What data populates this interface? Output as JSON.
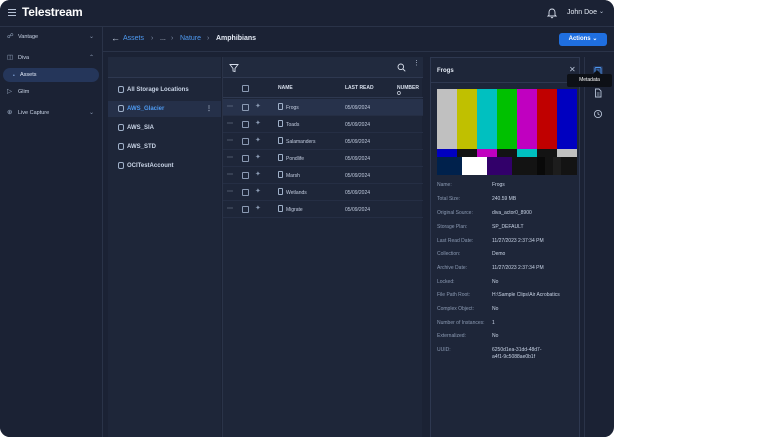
{
  "header": {
    "brand": "Telestream",
    "user_name": "John Doe"
  },
  "sidebar": {
    "items": [
      {
        "label": "Vantage",
        "icon": "share-nodes-icon"
      },
      {
        "label": "Diva",
        "icon": "database-icon"
      },
      {
        "label": "Assets",
        "icon": "dot-icon"
      },
      {
        "label": "Glim",
        "icon": "play-icon"
      },
      {
        "label": "Live Capture",
        "icon": "broadcast-icon"
      }
    ]
  },
  "breadcrumb": {
    "items": [
      "Assets",
      "...",
      "Nature",
      "Amphibians"
    ],
    "actions_label": "Actions"
  },
  "storage": {
    "items": [
      "All Storage Locations",
      "AWS_Glacier",
      "AWS_SIA",
      "AWS_STD",
      "OCITestAccount"
    ]
  },
  "files": {
    "columns": [
      "NAME",
      "LAST READ",
      "NUMBER O"
    ],
    "rows": [
      {
        "name": "Frogs",
        "last_read": "05/09/2024"
      },
      {
        "name": "Toads",
        "last_read": "05/09/2024"
      },
      {
        "name": "Salamanders",
        "last_read": "05/09/2024"
      },
      {
        "name": "Pondlife",
        "last_read": "05/09/2024"
      },
      {
        "name": "Marsh",
        "last_read": "05/09/2024"
      },
      {
        "name": "Wetlands",
        "last_read": "05/09/2024"
      },
      {
        "name": "Migrate",
        "last_read": "05/09/2024"
      }
    ]
  },
  "details": {
    "title": "Frogs",
    "metadata": [
      {
        "key": "Name:",
        "value": "Frogs"
      },
      {
        "key": "Total Size:",
        "value": "240.59 MB"
      },
      {
        "key": "Original Source:",
        "value": "diva_actor0_8900"
      },
      {
        "key": "Storage Plan:",
        "value": "SP_DEFAULT"
      },
      {
        "key": "Last Read Date:",
        "value": "11/27/2023 2:37:34 PM"
      },
      {
        "key": "Collection:",
        "value": "Demo"
      },
      {
        "key": "Archive Date:",
        "value": "11/27/2023 2:37:34 PM"
      },
      {
        "key": "Locked:",
        "value": "No"
      },
      {
        "key": "File Path Root:",
        "value": "H:\\Sample Clips\\Air Acrobatics"
      },
      {
        "key": "Complex Object:",
        "value": "No"
      },
      {
        "key": "Number of Instances:",
        "value": "1"
      },
      {
        "key": "Externalized:",
        "value": "No"
      },
      {
        "key": "UUID:",
        "value": "6250d1ea-31dd-48d7-",
        "value2": "a4f1-9c5088ae0b1f"
      }
    ]
  },
  "rail": {
    "tooltip": "Metadata"
  },
  "colors": {
    "accent": "#1f6fe0",
    "link": "#4e9af1",
    "background": "#1b2234"
  }
}
